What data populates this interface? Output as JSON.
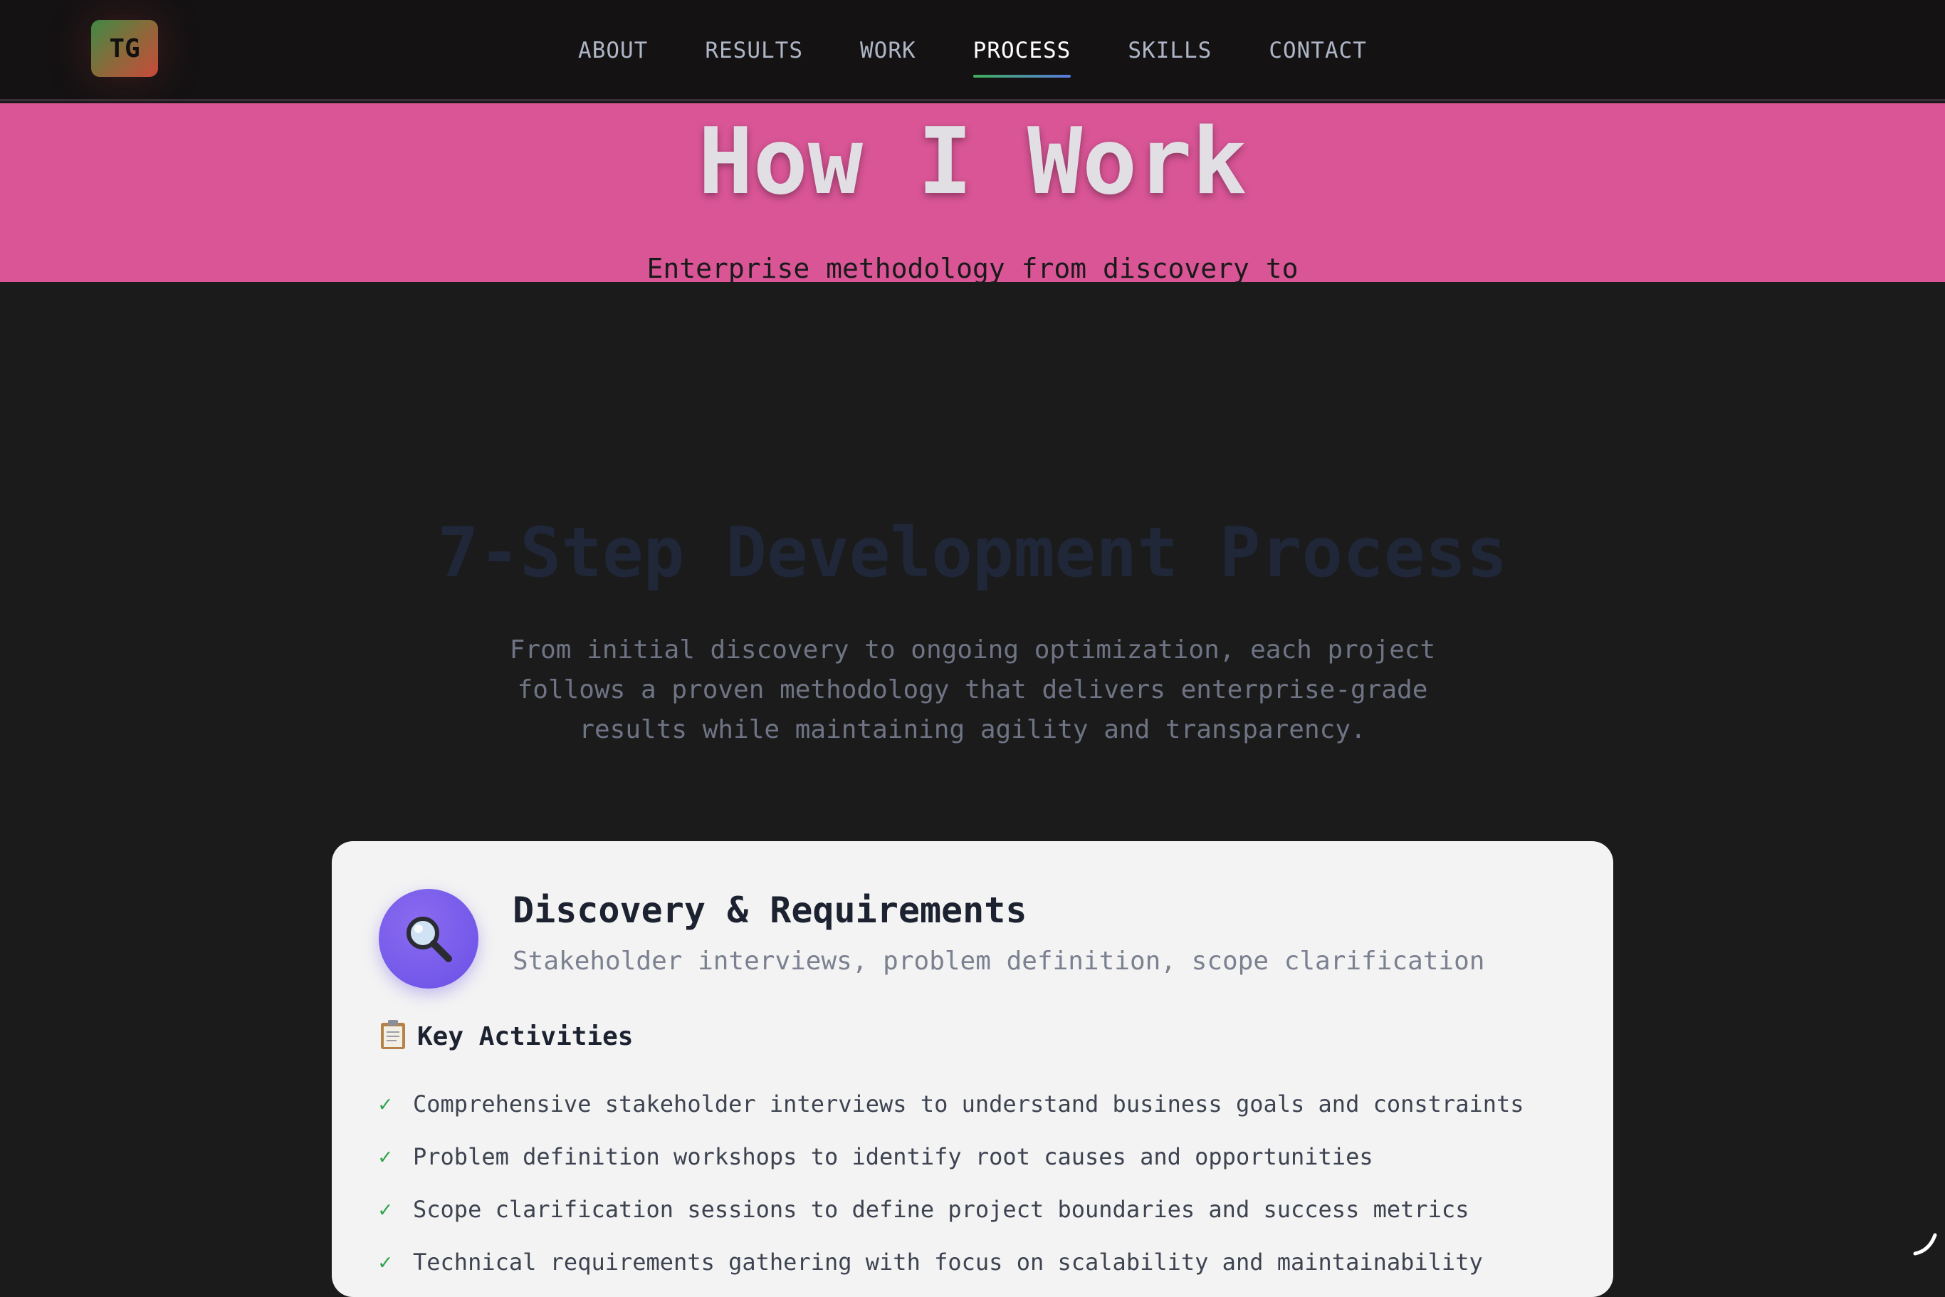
{
  "nav": {
    "logo_text": "TG",
    "links": [
      {
        "label": "ABOUT"
      },
      {
        "label": "RESULTS"
      },
      {
        "label": "WORK"
      },
      {
        "label": "PROCESS",
        "active": true
      },
      {
        "label": "SKILLS"
      },
      {
        "label": "CONTACT"
      }
    ]
  },
  "hero": {
    "title": "How I Work",
    "subtitle": "Enterprise methodology from discovery to",
    "background_color": "#d95596"
  },
  "process_section": {
    "title": "7-Step Development Process",
    "description": "From initial discovery to ongoing optimization, each project follows a proven methodology that delivers enterprise-grade results while maintaining agility and transparency."
  },
  "step_card": {
    "icon": "magnifying-glass-icon",
    "title": "Discovery & Requirements",
    "subtitle": "Stakeholder interviews, problem definition, scope clarification",
    "activities_icon": "clipboard-icon",
    "activities_label": "Key Activities",
    "activities": [
      "Comprehensive stakeholder interviews to understand business goals and constraints",
      "Problem definition workshops to identify root causes and opportunities",
      "Scope clarification sessions to define project boundaries and success metrics",
      "Technical requirements gathering with focus on scalability and maintainability"
    ],
    "check_color": "#2fa34a",
    "icon_color": "#6a4fe6"
  }
}
